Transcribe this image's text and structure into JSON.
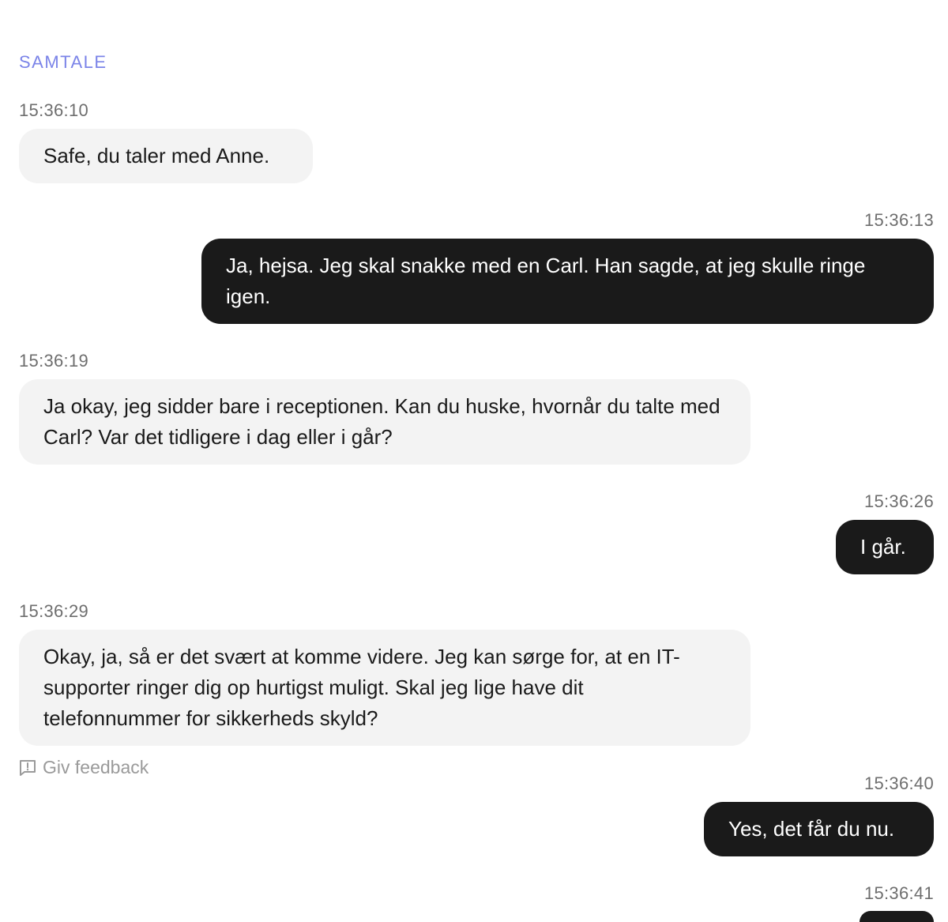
{
  "section_title": "SAMTALE",
  "messages": [
    {
      "role": "agent",
      "time": "15:36:10",
      "text": "Safe, du taler med Anne."
    },
    {
      "role": "user",
      "time": "15:36:13",
      "text": "Ja, hejsa. Jeg skal snakke med en Carl. Han sagde, at jeg skulle ringe igen."
    },
    {
      "role": "agent",
      "time": "15:36:19",
      "text": "Ja okay, jeg sidder bare i receptionen. Kan du huske, hvornår du talte med Carl? Var det tidligere i dag eller i går?"
    },
    {
      "role": "user",
      "time": "15:36:26",
      "text": "I går."
    },
    {
      "role": "agent",
      "time": "15:36:29",
      "text": "Okay, ja, så er det svært at komme videre. Jeg kan sørge for, at en IT-supporter ringer dig op hurtigst muligt. Skal jeg lige have dit telefonnummer for sikkerheds skyld?"
    },
    {
      "role": "user",
      "time": "15:36:40",
      "text": "Yes, det får du nu."
    },
    {
      "role": "user",
      "time": "15:36:41",
      "text": ""
    }
  ],
  "feedback": {
    "label": "Giv feedback",
    "icon": "feedback-icon"
  },
  "colors": {
    "accent": "#7b84e8",
    "agent_bubble": "#f3f3f3",
    "user_bubble": "#1a1a1a",
    "timestamp": "#6e6e6e",
    "feedback": "#9a9a9a"
  }
}
